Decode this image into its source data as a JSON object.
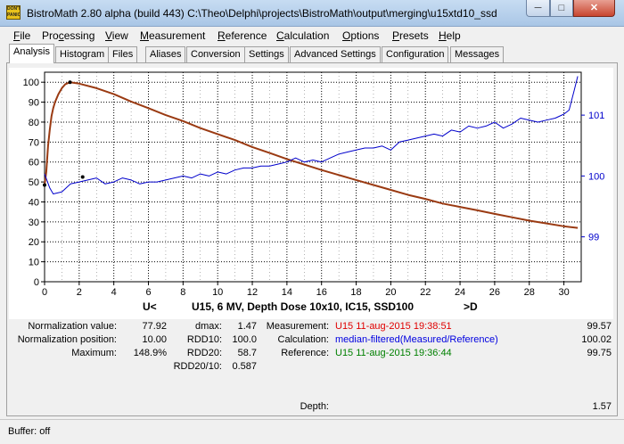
{
  "window": {
    "title": "BistroMath 2.80 alpha (build 443)   C:\\Theo\\Delphi\\projects\\BistroMath\\output\\merging\\u15xtd10_ssd",
    "icon_text": "DON'T PANIC",
    "minimize_label": "─",
    "maximize_label": "□",
    "close_label": "✕"
  },
  "menu": {
    "items": [
      {
        "accel": "F",
        "rest": "ile"
      },
      {
        "accel": "",
        "pre": "Pro",
        "mid": "c",
        "post": "essing"
      },
      {
        "accel": "V",
        "rest": "iew"
      },
      {
        "accel": "M",
        "rest": "easurement"
      },
      {
        "accel": "R",
        "rest": "eference"
      },
      {
        "accel": "C",
        "rest": "alculation"
      },
      {
        "accel": "O",
        "rest": "ptions"
      },
      {
        "accel": "P",
        "rest": "resets"
      },
      {
        "accel": "H",
        "rest": "elp"
      }
    ]
  },
  "tabs": [
    "Analysis",
    "Histogram",
    "Files",
    "Aliases",
    "Conversion",
    "Settings",
    "Advanced Settings",
    "Configuration",
    "Messages"
  ],
  "active_tab": "Analysis",
  "chart_data": {
    "type": "line",
    "title": "U15, 6 MV, Depth Dose 10x10, IC15, SSD100",
    "x_left_label": "U<",
    "x_right_label": ">D",
    "xlim": [
      0,
      31
    ],
    "ylim": [
      0,
      105
    ],
    "x_ticks": [
      0,
      2,
      4,
      6,
      8,
      10,
      12,
      14,
      16,
      18,
      20,
      22,
      24,
      26,
      28,
      30
    ],
    "y_ticks": [
      0,
      10,
      20,
      30,
      40,
      50,
      60,
      70,
      80,
      90,
      100
    ],
    "y2_ticks": [
      {
        "label": "99",
        "y": 22.5
      },
      {
        "label": "100",
        "y": 53
      },
      {
        "label": "101",
        "y": 83.5
      }
    ],
    "grid": true,
    "series": [
      {
        "values": [
          [
            0.0,
            48.5
          ],
          [
            0.1,
            55
          ],
          [
            0.2,
            68
          ],
          [
            0.3,
            76
          ],
          [
            0.4,
            83
          ],
          [
            0.5,
            87
          ],
          [
            0.6,
            90
          ],
          [
            0.8,
            94
          ],
          [
            1.0,
            97
          ],
          [
            1.2,
            99
          ],
          [
            1.47,
            100
          ],
          [
            2.0,
            99.3
          ],
          [
            3.0,
            97
          ],
          [
            4.0,
            94
          ],
          [
            5.0,
            90.3
          ],
          [
            6.0,
            87
          ],
          [
            7.0,
            83.5
          ],
          [
            8.0,
            80.5
          ],
          [
            9.0,
            77
          ],
          [
            10.0,
            74
          ],
          [
            11.0,
            71
          ],
          [
            12.0,
            67.5
          ],
          [
            13.0,
            64.5
          ],
          [
            14.0,
            61.5
          ],
          [
            15.0,
            58.7
          ],
          [
            16.0,
            56
          ],
          [
            17.0,
            53.5
          ],
          [
            18.0,
            51
          ],
          [
            19.0,
            48.5
          ],
          [
            20.0,
            46
          ],
          [
            21.0,
            43.5
          ],
          [
            22.0,
            41.5
          ],
          [
            23.0,
            39.2
          ],
          [
            24.0,
            37.5
          ],
          [
            25.0,
            35.8
          ],
          [
            26.0,
            34
          ],
          [
            27.0,
            32.3
          ],
          [
            28.0,
            30.6
          ],
          [
            29.0,
            29.2
          ],
          [
            30.0,
            27.8
          ],
          [
            30.8,
            27
          ]
        ],
        "color": "#9a3a12"
      },
      {
        "values": [
          [
            0.0,
            54
          ],
          [
            0.3,
            47
          ],
          [
            0.5,
            44
          ],
          [
            1.0,
            45
          ],
          [
            1.5,
            49
          ],
          [
            2.0,
            50
          ],
          [
            2.5,
            51
          ],
          [
            3.0,
            52
          ],
          [
            3.5,
            49
          ],
          [
            4.0,
            50
          ],
          [
            4.5,
            52
          ],
          [
            5.0,
            51
          ],
          [
            5.5,
            49
          ],
          [
            6.0,
            50
          ],
          [
            6.5,
            50
          ],
          [
            7.0,
            51
          ],
          [
            7.5,
            52
          ],
          [
            8.0,
            53
          ],
          [
            8.5,
            52
          ],
          [
            9.0,
            54
          ],
          [
            9.5,
            53
          ],
          [
            10.0,
            55
          ],
          [
            10.5,
            54
          ],
          [
            11.0,
            56
          ],
          [
            11.5,
            57
          ],
          [
            12.0,
            57
          ],
          [
            12.5,
            58
          ],
          [
            13.0,
            58
          ],
          [
            13.5,
            59
          ],
          [
            14.0,
            60
          ],
          [
            14.5,
            62
          ],
          [
            15.0,
            60
          ],
          [
            15.5,
            61
          ],
          [
            16.0,
            60
          ],
          [
            16.5,
            62
          ],
          [
            17.0,
            64
          ],
          [
            17.5,
            65
          ],
          [
            18.0,
            66
          ],
          [
            18.5,
            67
          ],
          [
            19.0,
            67
          ],
          [
            19.5,
            68
          ],
          [
            20.0,
            66
          ],
          [
            20.5,
            70
          ],
          [
            21.0,
            71
          ],
          [
            21.5,
            72
          ],
          [
            22.0,
            73
          ],
          [
            22.5,
            74
          ],
          [
            23.0,
            73
          ],
          [
            23.5,
            76
          ],
          [
            24.0,
            75
          ],
          [
            24.5,
            78
          ],
          [
            25.0,
            77
          ],
          [
            25.5,
            78
          ],
          [
            26.0,
            80
          ],
          [
            26.5,
            77
          ],
          [
            27.0,
            79
          ],
          [
            27.5,
            82
          ],
          [
            28.0,
            81
          ],
          [
            28.5,
            80
          ],
          [
            29.0,
            81
          ],
          [
            29.5,
            82
          ],
          [
            30.0,
            84
          ],
          [
            30.3,
            86
          ],
          [
            30.6,
            96
          ],
          [
            30.8,
            103
          ]
        ],
        "color": "#0000cc"
      }
    ],
    "markers": [
      {
        "x": 0.0,
        "y": 48.5
      },
      {
        "x": 1.47,
        "y": 100
      },
      {
        "x": 2.2,
        "y": 52.5
      }
    ]
  },
  "stats": {
    "norm_value_label": "Normalization value:",
    "norm_value": "77.92",
    "norm_pos_label": "Normalization position:",
    "norm_pos": "10.00",
    "maximum_label": "Maximum:",
    "maximum": "148.9%",
    "dmax_label": "dmax:",
    "dmax": "1.47",
    "rdd10_label": "RDD10:",
    "rdd10": "100.0",
    "rdd20_label": "RDD20:",
    "rdd20": "58.7",
    "rdd2010_label": "RDD20/10:",
    "rdd2010": "0.587",
    "measurement_label": "Measurement:",
    "measurement": "U15 11-aug-2015 19:38:51",
    "measurement_val": "99.57",
    "calculation_label": "Calculation:",
    "calculation": "median-filtered(Measured/Reference)",
    "calculation_val": "100.02",
    "reference_label": "Reference:",
    "reference": "U15 11-aug-2015 19:36:44",
    "reference_val": "99.75",
    "depth_label": "Depth:",
    "depth_val": "1.57"
  },
  "status": {
    "text": "Buffer: off"
  }
}
